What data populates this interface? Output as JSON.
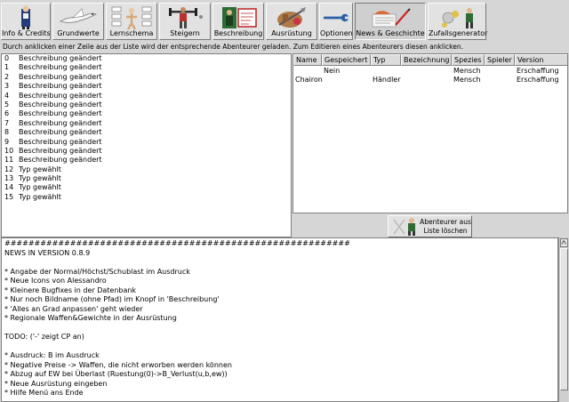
{
  "toolbar": {
    "buttons": [
      {
        "label": "Info & Credits",
        "icon": "figure-icon"
      },
      {
        "label": "Grundwerte",
        "icon": "dove-icon"
      },
      {
        "label": "Lernschema",
        "icon": "schema-icon"
      },
      {
        "label": "Steigern",
        "icon": "weights-icon"
      },
      {
        "label": "Beschreibung",
        "icon": "portrait-icon"
      },
      {
        "label": "Ausrüstung",
        "icon": "equipment-icon"
      },
      {
        "label": "Optionen",
        "icon": "wrench-icon"
      },
      {
        "label": "News & Geschichte",
        "icon": "news-icon"
      },
      {
        "label": "Zufallsgenerator",
        "icon": "dice-icon"
      }
    ]
  },
  "hint": "Durch anklicken einer Zeile aus der Liste wird der entsprechende Abenteurer geladen. Zum Editieren eines Abenteurers diesen anklicken.",
  "change_list": [
    {
      "num": "0",
      "text": "Beschreibung geändert"
    },
    {
      "num": "1",
      "text": "Beschreibung geändert"
    },
    {
      "num": "2",
      "text": "Beschreibung geändert"
    },
    {
      "num": "3",
      "text": "Beschreibung geändert"
    },
    {
      "num": "4",
      "text": "Beschreibung geändert"
    },
    {
      "num": "5",
      "text": "Beschreibung geändert"
    },
    {
      "num": "6",
      "text": "Beschreibung geändert"
    },
    {
      "num": "7",
      "text": "Beschreibung geändert"
    },
    {
      "num": "8",
      "text": "Beschreibung geändert"
    },
    {
      "num": "9",
      "text": "Beschreibung geändert"
    },
    {
      "num": "10",
      "text": "Beschreibung geändert"
    },
    {
      "num": "11",
      "text": "Beschreibung geändert"
    },
    {
      "num": "12",
      "text": "Typ gewählt"
    },
    {
      "num": "13",
      "text": "Typ gewählt"
    },
    {
      "num": "14",
      "text": "Typ gewählt"
    },
    {
      "num": "15",
      "text": "Typ gewählt"
    }
  ],
  "adventurer_table": {
    "columns": [
      "Name",
      "Gespeichert",
      "Typ",
      "Bezeichnung",
      "Spezies",
      "Spieler",
      "Version"
    ],
    "rows": [
      [
        "",
        "Nein",
        "",
        "",
        "Mensch",
        "",
        "Erschaffung"
      ],
      [
        "Chairon",
        "",
        "Händler",
        "",
        "Mensch",
        "",
        "Erschaffung"
      ]
    ]
  },
  "delete_button": {
    "line1": "Abenteurer aus",
    "line2": "Liste löschen",
    "icon": "delete-adventurer-icon"
  },
  "news_lines": [
    "##########################################################",
    "NEWS IN VERSION 0.8.9",
    "",
    "* Angabe der Normal/Höchst/Schublast im Ausdruck",
    "* Neue Icons von Alessandro",
    "* Kleinere Bugfixes in der Datenbank",
    "* Nur noch Bildname (ohne Pfad) im Knopf in 'Beschreibung'",
    "* 'Alles an Grad anpassen' geht wieder",
    "* Regionale Waffen&Gewichte in der Ausrüstung",
    "",
    "TODO: ('-' zeigt CP an)",
    "",
    "* Ausdruck: B im Ausdruck",
    "* Negative Preise -> Waffen, die nicht erworben werden können",
    "* Abzug auf EW bei Überlast (Ruestung(0)->B_Verlust(u,b,ew))",
    "* Neue Ausrüstung eingeben",
    "* Hilfe Menü ans Ende"
  ]
}
